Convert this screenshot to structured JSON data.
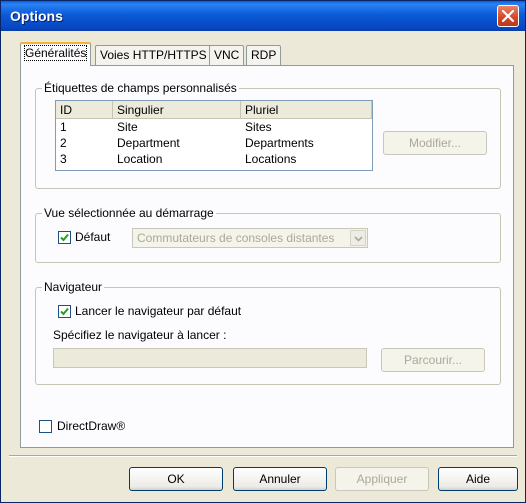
{
  "window": {
    "title": "Options"
  },
  "tabs": [
    {
      "label": "Généralités",
      "active": true
    },
    {
      "label": "Voies HTTP/HTTPS"
    },
    {
      "label": "VNC"
    },
    {
      "label": "RDP"
    }
  ],
  "fields_group": {
    "legend": "Étiquettes de champs personnalisés",
    "columns": [
      "ID",
      "Singulier",
      "Pluriel"
    ],
    "rows": [
      [
        "1",
        "Site",
        "Sites"
      ],
      [
        "2",
        "Department",
        "Departments"
      ],
      [
        "3",
        "Location",
        "Locations"
      ]
    ],
    "modify_label": "Modifier..."
  },
  "startup_group": {
    "legend": "Vue sélectionnée au démarrage",
    "default_label": "Défaut",
    "default_checked": true,
    "view_value": "Commutateurs de consoles distantes"
  },
  "browser_group": {
    "legend": "Navigateur",
    "launch_label": "Lancer le navigateur par défaut",
    "launch_checked": true,
    "specify_label": "Spécifiez le navigateur à lancer :",
    "path_value": "",
    "browse_label": "Parcourir..."
  },
  "directdraw": {
    "label": "DirectDraw®",
    "checked": false
  },
  "footer": {
    "ok_label": "OK",
    "cancel_label": "Annuler",
    "apply_label": "Appliquer",
    "help_label": "Aide"
  },
  "colors": {
    "titlebar": "#0b5bd6",
    "dialog_bg": "#ece9d8",
    "panel_bg": "#fcfcfe",
    "active_tab_accent": "#f5b335",
    "disabled_text": "#aca899"
  },
  "icons": {
    "close": "close-icon",
    "check": "checkmark-icon",
    "dropdown": "chevron-down-icon"
  }
}
